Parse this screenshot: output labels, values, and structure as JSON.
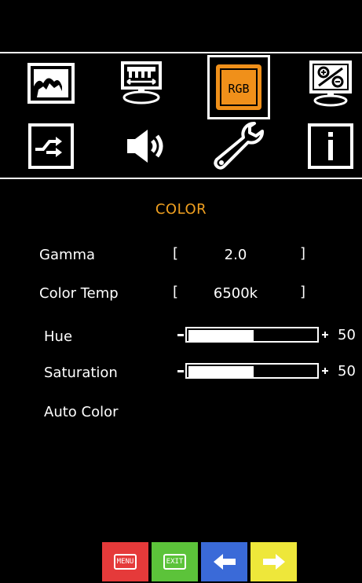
{
  "osd": {
    "icons": [
      {
        "name": "picture-icon",
        "selected": false
      },
      {
        "name": "display-position-icon",
        "selected": false
      },
      {
        "name": "rgb-color-icon",
        "label": "RGB",
        "selected": true
      },
      {
        "name": "zoom-percent-icon",
        "selected": false
      },
      {
        "name": "input-source-icon",
        "selected": false
      },
      {
        "name": "audio-speaker-icon",
        "selected": false
      },
      {
        "name": "setup-wrench-icon",
        "selected": false
      },
      {
        "name": "info-icon",
        "selected": false
      }
    ],
    "section_title": "COLOR",
    "settings": {
      "gamma": {
        "label": "Gamma",
        "open": "[",
        "value": "2.0",
        "close": "]"
      },
      "color_temp": {
        "label": "Color Temp",
        "open": "[",
        "value": "6500k",
        "close": "]"
      },
      "hue": {
        "label": "Hue",
        "value": "50",
        "level": 0.5
      },
      "saturation": {
        "label": "Saturation",
        "value": "50",
        "level": 0.5
      },
      "auto_color": {
        "label": "Auto Color"
      }
    },
    "buttons": {
      "menu": "MENU",
      "exit": "EXIT"
    }
  }
}
